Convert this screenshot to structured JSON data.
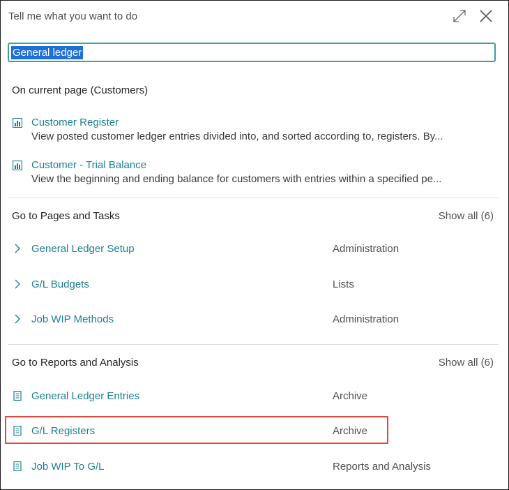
{
  "header": {
    "title": "Tell me what you want to do",
    "expand_icon": "expand-icon",
    "close_icon": "close-icon"
  },
  "search": {
    "value": "General ledger"
  },
  "current_page": {
    "heading": "On current page (Customers)",
    "items": [
      {
        "icon": "report-icon",
        "title": "Customer Register",
        "desc": "View posted customer ledger entries divided into, and sorted according to, registers. By..."
      },
      {
        "icon": "report-icon",
        "title": "Customer - Trial Balance",
        "desc": "View the beginning and ending balance for customers with entries within a specified pe..."
      }
    ]
  },
  "pages_tasks": {
    "heading": "Go to Pages and Tasks",
    "show_all": "Show all (6)",
    "items": [
      {
        "icon": "chevron-right-icon",
        "title": "General Ledger Setup",
        "category": "Administration"
      },
      {
        "icon": "chevron-right-icon",
        "title": "G/L Budgets",
        "category": "Lists"
      },
      {
        "icon": "chevron-right-icon",
        "title": "Job WIP Methods",
        "category": "Administration"
      }
    ]
  },
  "reports_analysis": {
    "heading": "Go to Reports and Analysis",
    "show_all": "Show all (6)",
    "items": [
      {
        "icon": "document-icon",
        "title": "General Ledger Entries",
        "category": "Archive"
      },
      {
        "icon": "document-icon",
        "title": "G/L Registers",
        "category": "Archive",
        "highlighted": true
      },
      {
        "icon": "document-icon",
        "title": "Job WIP To G/L",
        "category": "Reports and Analysis"
      }
    ]
  },
  "colors": {
    "link": "#1d7f8c",
    "focus_border": "#3aa0a0",
    "selection": "#1e6fd9",
    "highlight_box": "#e0463c"
  }
}
